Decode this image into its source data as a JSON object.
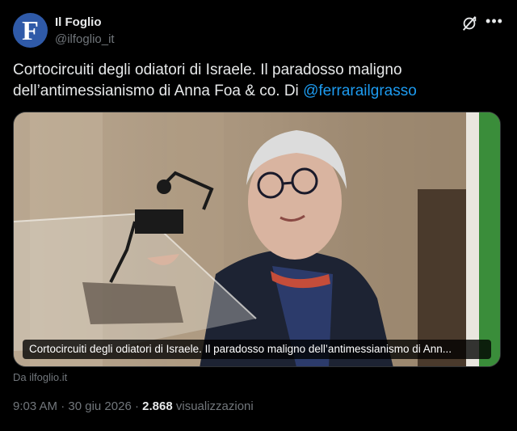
{
  "author": {
    "avatar_letter": "F",
    "name": "Il Foglio",
    "handle": "@ilfoglio_it"
  },
  "tweet": {
    "text_line1": "Cortocircuiti degli odiatori di Israele. Il paradosso maligno",
    "text_line2": "dell’antimessianismo di Anna Foa & co. Di ",
    "mention": "@ferrarailgrasso"
  },
  "card": {
    "caption": "Cortocircuiti degli odiatori di Israele. Il paradosso maligno dell’antimessianismo di Ann...",
    "source": "Da ilfoglio.it"
  },
  "meta": {
    "time": "9:03 AM",
    "separator": "·",
    "date": "30 giu 2026",
    "views_count": "2.868",
    "views_label": "visualizzazioni"
  },
  "icons": {
    "grok": "grok-icon",
    "more": "more-icon"
  },
  "colors": {
    "background": "#000000",
    "text": "#e7e9ea",
    "secondary": "#71767b",
    "link": "#1d9bf0",
    "avatar": "#2f5aa8"
  }
}
